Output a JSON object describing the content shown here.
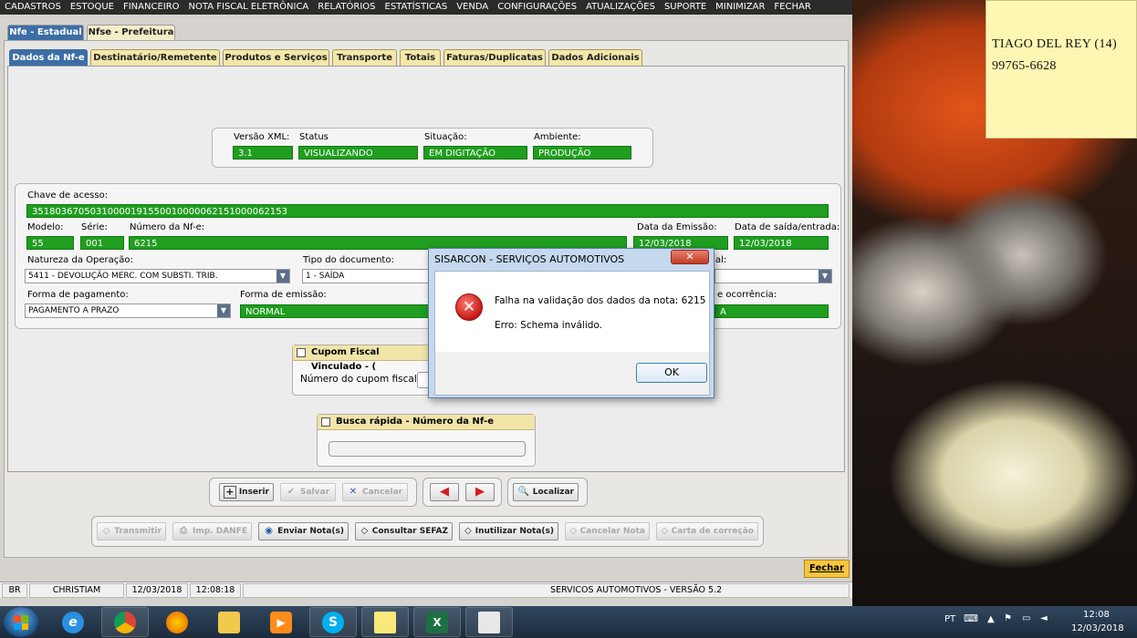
{
  "menu": [
    "CADASTROS",
    "ESTOQUE",
    "FINANCEIRO",
    "NOTA FISCAL ELETRÔNICA",
    "RELATÓRIOS",
    "ESTATÍSTICAS",
    "VENDA",
    "CONFIGURAÇÕES",
    "ATUALIZAÇÕES",
    "SUPORTE",
    "MINIMIZAR",
    "FECHAR"
  ],
  "top_tabs": [
    "Nfe - Estadual",
    "Nfse - Prefeitura"
  ],
  "sub_tabs": [
    "Dados da Nf-e",
    "Destinatário/Remetente",
    "Produtos e Serviços",
    "Transporte",
    "Totais",
    "Faturas/Duplicatas",
    "Dados Adicionais"
  ],
  "header": {
    "versao_label": "Versão XML:",
    "versao": "3.1",
    "status_label": "Status",
    "status": "VISUALIZANDO",
    "situacao_label": "Situação:",
    "situacao": "EM DIGITAÇÃO",
    "ambiente_label": "Ambiente:",
    "ambiente": "PRODUÇÃO"
  },
  "form": {
    "chave_label": "Chave de acesso:",
    "chave": "35180367050310000191550010000062151000062153",
    "modelo_label": "Modelo:",
    "modelo": "55",
    "serie_label": "Série:",
    "serie": "001",
    "numero_label": "Número da Nf-e:",
    "numero": "6215",
    "data_emissao_label": "Data da Emissão:",
    "data_emissao": "12/03/2018",
    "data_saida_label": "Data de saída/entrada:",
    "data_saida": "12/03/2018",
    "natureza_label": "Natureza da Operação:",
    "natureza": "5411 - DEVOLUÇÃO MERC. COM SUBSTI. TRIB.",
    "tipo_doc_label": "Tipo do documento:",
    "tipo_doc": "1 - SAÍDA",
    "partial_label_right": "al:",
    "pagamento_label": "Forma de pagamento:",
    "pagamento": "PAGAMENTO A PRAZO",
    "emissao_label": "Forma de emissão:",
    "emissao": "NORMAL",
    "ocorrencia_label": "e ocorrência:",
    "ocorrencia_partial": "A"
  },
  "cupom": {
    "title": "Cupom Fiscal Vinculado - (",
    "label": "Número do cupom fiscal"
  },
  "busca": {
    "title": "Busca rápida - Número da Nf-e"
  },
  "actions": {
    "inserir": "Inserir",
    "salvar": "Salvar",
    "cancelar": "Cancelar",
    "localizar": "Localizar"
  },
  "nfe_actions": [
    "Transmitir",
    "Imp. DANFE",
    "Enviar Nota(s)",
    "Consultar SEFAZ",
    "Inutilizar Nota(s)",
    "Cancelar Nota",
    "Carta de correção"
  ],
  "fechar": "Fechar",
  "statusbar": {
    "br": "BR",
    "user": "CHRISTIAM",
    "date": "12/03/2018",
    "time": "12:08:18",
    "app": "SERVICOS AUTOMOTIVOS - VERSÃO 5.2"
  },
  "dialog": {
    "title": "SISARCON - SERVIÇOS AUTOMOTIVOS",
    "close": "✕",
    "message1": "Falha na validação dos dados da nota: 6215",
    "message2": "Erro: Schema inválido.",
    "ok": "OK"
  },
  "sticky": {
    "line1": "TIAGO DEL REY (14)",
    "line2": "99765-6628"
  },
  "tray": {
    "lang": "PT",
    "time": "12:08",
    "date": "12/03/2018"
  },
  "taskbar_icons": [
    "internet-explorer-icon",
    "chrome-icon",
    "firefox-icon",
    "file-explorer-icon",
    "media-player-icon",
    "skype-icon",
    "sticky-notes-icon",
    "excel-icon",
    "app-icon"
  ],
  "colors": {
    "field_green": "#1f9e1f",
    "tab_active": "#3c6ea5",
    "tab_inactive": "#f3e7a9",
    "fechar_yellow": "#f6c640"
  }
}
